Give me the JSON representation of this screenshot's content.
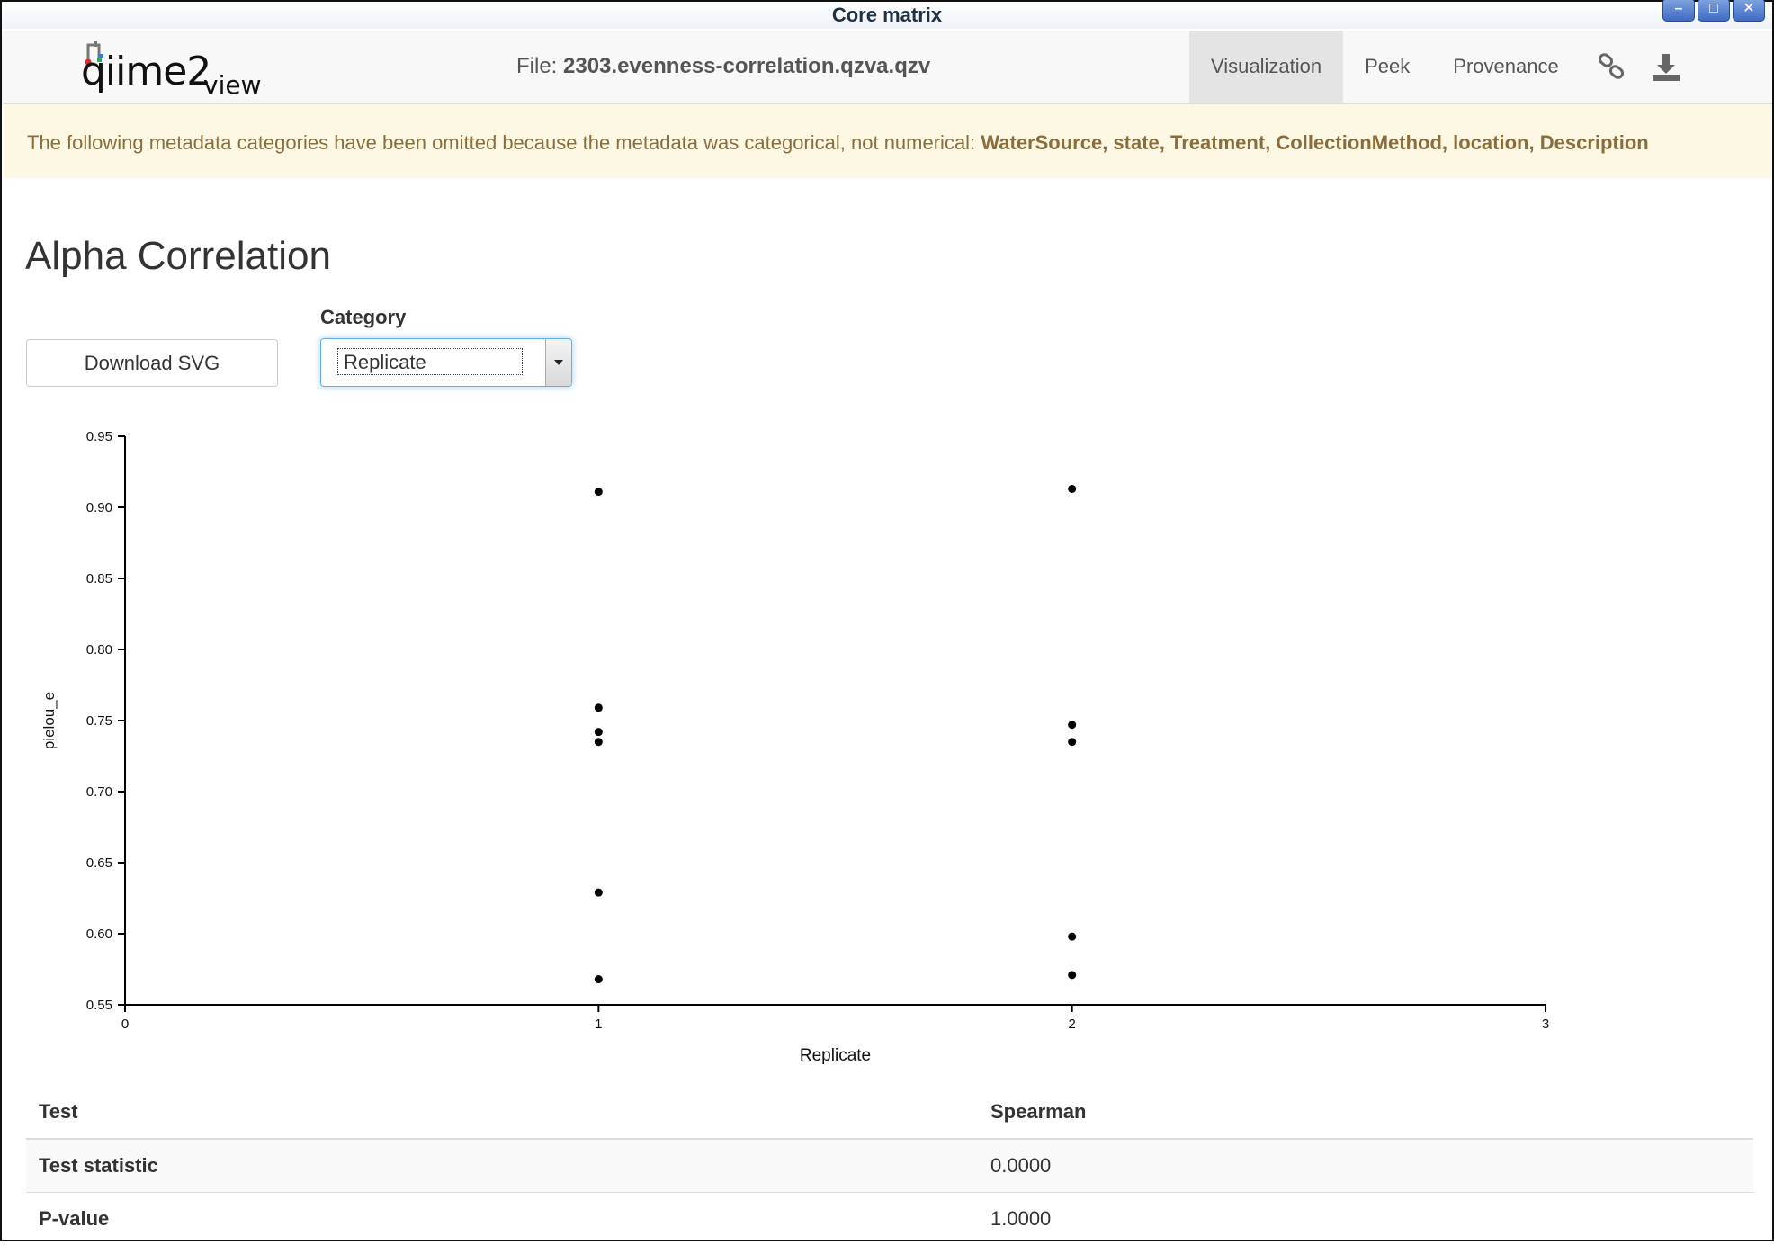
{
  "window": {
    "title": "Core matrix",
    "buttons": [
      "–",
      "□",
      "✕"
    ]
  },
  "navbar": {
    "logo_text": "qiime2",
    "logo_suffix": "view",
    "file_prefix": "File:",
    "file_name": "2303.evenness-correlation.qzva.qzv",
    "tabs": [
      {
        "label": "Visualization",
        "active": true
      },
      {
        "label": "Peek",
        "active": false
      },
      {
        "label": "Provenance",
        "active": false
      }
    ],
    "icons": [
      "link-icon",
      "download-icon"
    ]
  },
  "banner": {
    "text": "The following metadata categories have been omitted because the metadata was categorical, not numerical:",
    "categories": "WaterSource, state, Treatment, CollectionMethod, location, Description"
  },
  "page_title": "Alpha Correlation",
  "controls": {
    "download_label": "Download SVG",
    "category_label": "Category",
    "category_value": "Replicate"
  },
  "chart_data": {
    "type": "scatter",
    "xlabel": "Replicate",
    "ylabel": "pielou_e",
    "xlim": [
      0,
      3
    ],
    "ylim": [
      0.55,
      0.95
    ],
    "xticks": [
      "0",
      "1",
      "2",
      "3"
    ],
    "yticks": [
      "0.55",
      "0.60",
      "0.65",
      "0.70",
      "0.75",
      "0.80",
      "0.85",
      "0.90",
      "0.95"
    ],
    "grid": false,
    "points": [
      {
        "x": 1,
        "y": 0.911
      },
      {
        "x": 1,
        "y": 0.759
      },
      {
        "x": 1,
        "y": 0.742
      },
      {
        "x": 1,
        "y": 0.735
      },
      {
        "x": 1,
        "y": 0.629
      },
      {
        "x": 1,
        "y": 0.568
      },
      {
        "x": 2,
        "y": 0.913
      },
      {
        "x": 2,
        "y": 0.747
      },
      {
        "x": 2,
        "y": 0.735
      },
      {
        "x": 2,
        "y": 0.598
      },
      {
        "x": 2,
        "y": 0.571
      }
    ]
  },
  "stats_table": {
    "headers": [
      "Test",
      "Spearman"
    ],
    "rows": [
      [
        "Test statistic",
        "0.0000"
      ],
      [
        "P-value",
        "1.0000"
      ]
    ]
  }
}
